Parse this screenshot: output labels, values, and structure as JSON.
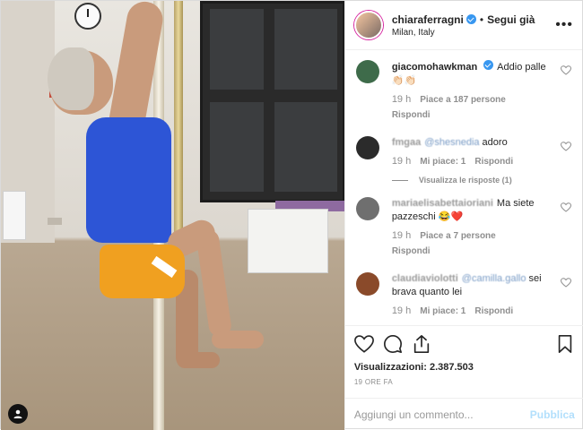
{
  "header": {
    "username": "chiaraferragni",
    "follow_sep": "•",
    "follow": "Segui già",
    "location": "Milan, Italy",
    "more": "•••"
  },
  "comments": [
    {
      "user": "giacomohawkman",
      "verified": true,
      "text": "Addio palle 👏🏻👏🏻",
      "time": "19 h",
      "likes": "Piace a 187 persone",
      "reply": "Rispondi",
      "avatar_color": "#3e6b4a"
    },
    {
      "user": "fmgaa",
      "mention": "@shesnedia",
      "text": "adoro",
      "time": "19 h",
      "likes": "Mi piace: 1",
      "reply": "Rispondi",
      "view_replies": "Visualizza le risposte (1)",
      "avatar_color": "#2b2b2b"
    },
    {
      "user": "mariaelisabettaioriani",
      "text": "Ma siete pazzeschi 😂❤️",
      "time": "19 h",
      "likes": "Piace a 7 persone",
      "reply": "Rispondi",
      "avatar_color": "#6f6f6f"
    },
    {
      "user": "claudiaviolotti",
      "mention": "@camilla.gallo",
      "text": "sei brava quanto lei",
      "time": "19 h",
      "likes": "Mi piace: 1",
      "reply": "Rispondi",
      "avatar_color": "#8a4a2a"
    }
  ],
  "actions": {
    "like_icon": "heart-icon",
    "comment_icon": "comment-bubble-icon",
    "share_icon": "share-icon",
    "save_icon": "bookmark-icon"
  },
  "stats": {
    "views": "Visualizzazioni: 2.387.503",
    "posted": "19 ORE FA"
  },
  "composer": {
    "placeholder": "Aggiungi un commento...",
    "publish": "Pubblica"
  },
  "colors": {
    "verified": "#3897f0",
    "publish_disabled": "#b2dffc",
    "tank": "#2d55d6",
    "shorts": "#f0a020"
  }
}
